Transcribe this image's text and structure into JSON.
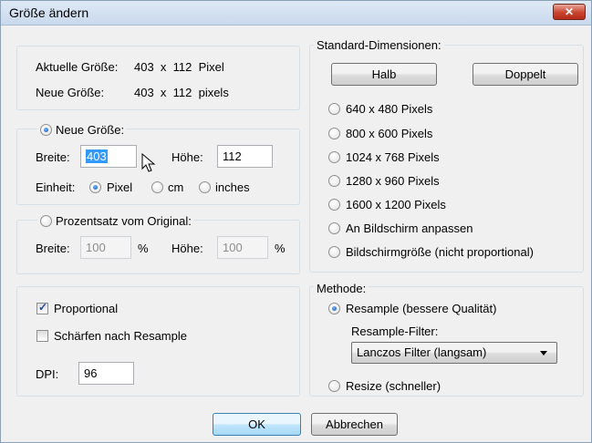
{
  "window": {
    "title": "Größe ändern",
    "close_label": "✕"
  },
  "current_size": {
    "current_label": "Aktuelle Größe:",
    "current_value": "403  x  112  Pixel",
    "new_label": "Neue Größe:",
    "new_value": "403  x  112  pixels"
  },
  "new_size_group": {
    "radio_label": "Neue Größe:",
    "width_label": "Breite:",
    "width_value": "403",
    "height_label": "Höhe:",
    "height_value": "112",
    "unit_label": "Einheit:",
    "units": [
      "Pixel",
      "cm",
      "inches"
    ],
    "selected_unit": "Pixel"
  },
  "percent_group": {
    "radio_label": "Prozentsatz vom Original:",
    "width_label": "Breite:",
    "width_value": "100",
    "percent_sign": "%",
    "height_label": "Höhe:",
    "height_value": "100"
  },
  "options": {
    "proportional_label": "Proportional",
    "proportional_checked": true,
    "sharpen_label": "Schärfen nach Resample",
    "sharpen_checked": false,
    "dpi_label": "DPI:",
    "dpi_value": "96"
  },
  "standard": {
    "legend": "Standard-Dimensionen:",
    "half_label": "Halb",
    "double_label": "Doppelt",
    "presets": [
      "640 x 480 Pixels",
      "800 x 600 Pixels",
      "1024 x 768 Pixels",
      "1280 x 960 Pixels",
      "1600 x 1200 Pixels",
      "An Bildschirm anpassen",
      "Bildschirmgröße (nicht proportional)"
    ]
  },
  "method": {
    "legend": "Methode:",
    "resample_label": "Resample (bessere Qualität)",
    "resample_selected": true,
    "filter_label": "Resample-Filter:",
    "filter_value": "Lanczos Filter (langsam)",
    "resize_label": "Resize (schneller)"
  },
  "footer": {
    "ok_label": "OK",
    "cancel_label": "Abbrechen"
  },
  "colors": {
    "title_gradient_top": "#dfe9f5",
    "close_red": "#c8442f",
    "selection_blue": "#3399ff",
    "default_button": "#bee6fd"
  },
  "icons": [
    "close-icon",
    "mouse-cursor-icon",
    "dropdown-arrow-icon",
    "checkmark-icon"
  ]
}
